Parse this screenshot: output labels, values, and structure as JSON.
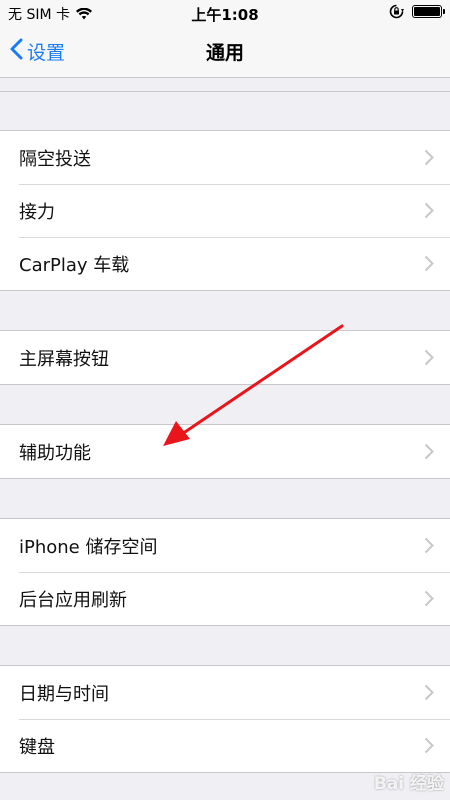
{
  "status_bar": {
    "carrier": "无 SIM 卡",
    "time": "上午1:08",
    "battery_percent": 100,
    "icons": [
      "wifi-icon",
      "rotation-lock-icon",
      "battery-icon"
    ]
  },
  "nav": {
    "back_label": "设置",
    "title": "通用",
    "back_icon": "chevron-left-icon"
  },
  "groups": [
    {
      "items": [
        {
          "label": "隔空投送"
        },
        {
          "label": "接力"
        },
        {
          "label": "CarPlay 车载"
        }
      ]
    },
    {
      "items": [
        {
          "label": "主屏幕按钮"
        }
      ]
    },
    {
      "items": [
        {
          "label": "辅助功能"
        }
      ]
    },
    {
      "items": [
        {
          "label": "iPhone 储存空间"
        },
        {
          "label": "后台应用刷新"
        }
      ]
    },
    {
      "items": [
        {
          "label": "日期与时间"
        },
        {
          "label": "键盘"
        }
      ]
    }
  ],
  "colors": {
    "accent": "#1a7cf5",
    "background": "#efeff4",
    "separator": "#c8c7cc",
    "chevron": "#c7c7cc",
    "annotation": "#e8161b"
  },
  "watermark": "Bai 经验"
}
